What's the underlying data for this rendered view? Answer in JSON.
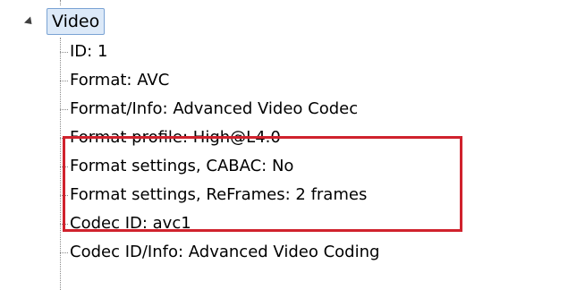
{
  "tree": {
    "root": {
      "label": "Video",
      "expanded": true
    },
    "children": [
      {
        "label": "ID: 1"
      },
      {
        "label": "Format: AVC"
      },
      {
        "label": "Format/Info: Advanced Video Codec"
      },
      {
        "label": "Format profile: High@L4.0"
      },
      {
        "label": "Format settings, CABAC: No"
      },
      {
        "label": "Format settings, ReFrames: 2 frames"
      },
      {
        "label": "Codec ID: avc1"
      },
      {
        "label": "Codec ID/Info: Advanced Video Coding"
      }
    ]
  },
  "annotation": {
    "color": "#d0222d"
  }
}
